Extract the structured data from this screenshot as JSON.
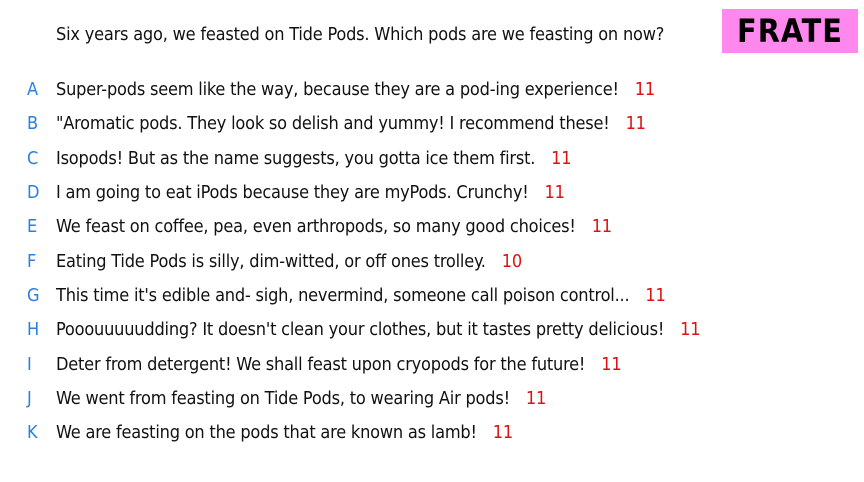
{
  "prompt": "Six years ago, we feasted on Tide Pods. Which pods are we feasting on now?",
  "badge": {
    "label": "FRATE",
    "color": "#ff88ee"
  },
  "colors": {
    "letter": "#2a7fe0",
    "score": "#dd1111"
  },
  "answers": [
    {
      "letter": "A",
      "text": "Super-pods seem like the way, because they are a pod-ing experience!",
      "score": "11"
    },
    {
      "letter": "B",
      "text": "\"Aromatic pods. They look so delish and yummy! I recommend these!",
      "score": "11"
    },
    {
      "letter": "C",
      "text": "Isopods! But as the name suggests, you gotta ice them first.",
      "score": "11"
    },
    {
      "letter": "D",
      "text": "I am going to eat iPods because they are myPods. Crunchy!",
      "score": "11"
    },
    {
      "letter": "E",
      "text": "We feast on coffee, pea, even arthropods, so many good choices!",
      "score": "11"
    },
    {
      "letter": "F",
      "text": "Eating Tide Pods is silly, dim-witted, or off ones trolley.",
      "score": "10"
    },
    {
      "letter": "G",
      "text": "This time it's edible and- sigh, nevermind, someone call poison control...",
      "score": "11"
    },
    {
      "letter": "H",
      "text": "Pooouuuuudding? It doesn't clean your clothes, but it tastes pretty delicious!",
      "score": "11"
    },
    {
      "letter": "I",
      "text": "Deter from detergent! We shall feast upon cryopods for the future!",
      "score": "11"
    },
    {
      "letter": "J",
      "text": "We went from feasting on Tide Pods, to wearing Air pods!",
      "score": "11"
    },
    {
      "letter": "K",
      "text": "We are feasting on the pods that are known as lamb!",
      "score": "11"
    }
  ]
}
